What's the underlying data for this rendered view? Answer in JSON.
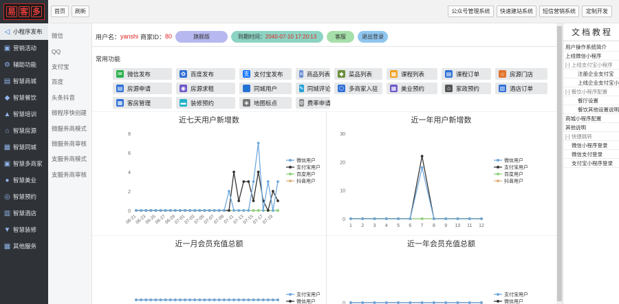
{
  "logo": {
    "chars": [
      "易",
      "客",
      "多"
    ]
  },
  "sidebar": {
    "items": [
      {
        "label": "小程序发布",
        "icon": "send-icon",
        "active": true
      },
      {
        "label": "营销活动",
        "icon": "tag-icon"
      },
      {
        "label": "辅助功能",
        "icon": "settings-icon"
      },
      {
        "label": "智慧商城",
        "icon": "shop-icon"
      },
      {
        "label": "智慧餐饮",
        "icon": "dining-icon"
      },
      {
        "label": "智慧培训",
        "icon": "training-icon"
      },
      {
        "label": "智慧房源",
        "icon": "house-icon"
      },
      {
        "label": "智慧同城",
        "icon": "city-icon"
      },
      {
        "label": "智慧多商家",
        "icon": "merchants-icon"
      },
      {
        "label": "智慧美业",
        "icon": "beauty-icon"
      },
      {
        "label": "智慧预约",
        "icon": "appointment-icon"
      },
      {
        "label": "智慧酒店",
        "icon": "hotel-icon"
      },
      {
        "label": "智慧装修",
        "icon": "decoration-icon"
      },
      {
        "label": "其他服务",
        "icon": "grid-icon"
      }
    ]
  },
  "submenu": {
    "items": [
      "微信",
      "QQ",
      "支付宝",
      "百度",
      "头条抖音",
      "微程序快创建",
      "微服务商模式",
      "微服务商审核",
      "支服务商模式",
      "支服务商审核"
    ]
  },
  "topbar": {
    "home": "首页",
    "refresh": "刷新",
    "right_buttons": [
      "公众号管理系统",
      "快速建站系统",
      "短信营销系统",
      "定制开发"
    ]
  },
  "user": {
    "username_label": "用户名：",
    "username": "yanshi",
    "merchant_label": "商家ID：",
    "merchant_id": "80",
    "edition": "旗舰版",
    "expire_label": "到期时间：",
    "expire_time": "2040-07-10 17:20:13",
    "service": "客服",
    "logout": "退出登录"
  },
  "common": {
    "title": "常用功能",
    "buttons": [
      {
        "label": "微信发布",
        "icon": "wechat-icon",
        "color": "#2bb24c"
      },
      {
        "label": "百度发布",
        "icon": "baidu-paw-icon",
        "color": "#2f6fd6"
      },
      {
        "label": "支付宝发布",
        "icon": "alipay-icon",
        "color": "#1677ff"
      },
      {
        "label": "商品列表",
        "icon": "list-icon",
        "color": "#6b8fd4"
      },
      {
        "label": "菜品列表",
        "icon": "dish-icon",
        "color": "#6a8f3a"
      },
      {
        "label": "课程列表",
        "icon": "course-list-icon",
        "color": "#f0a020"
      },
      {
        "label": "课程订单",
        "icon": "order-icon",
        "color": "#2f6fd6"
      },
      {
        "label": "房源门店",
        "icon": "store-icon",
        "color": "#e2742c"
      },
      {
        "label": "房源申请",
        "icon": "apply-icon",
        "color": "#2f6fd6"
      },
      {
        "label": "房源求租",
        "icon": "rent-icon",
        "color": "#6f57c7"
      },
      {
        "label": "同城用户",
        "icon": "user-icon",
        "color": "#2f6fd6"
      },
      {
        "label": "同城评论",
        "icon": "comment-icon",
        "color": "#23a0d6"
      },
      {
        "label": "多商家入驻",
        "icon": "join-icon",
        "color": "#2f6fd6"
      },
      {
        "label": "美业预约",
        "icon": "beauty-book-icon",
        "color": "#6f57c7"
      },
      {
        "label": "家政预约",
        "icon": "housekeeping-icon",
        "color": "#555555"
      },
      {
        "label": "酒店订单",
        "icon": "hotel-order-icon",
        "color": "#2f6fd6"
      },
      {
        "label": "客房管理",
        "icon": "room-icon",
        "color": "#2f6fd6"
      },
      {
        "label": "装修预约",
        "icon": "decor-book-icon",
        "color": "#23b3c8"
      },
      {
        "label": "地图标点",
        "icon": "map-pin-icon",
        "color": "#777777"
      },
      {
        "label": "费率申请",
        "icon": "rate-icon",
        "color": "#888888"
      }
    ]
  },
  "chart_data": [
    {
      "type": "line",
      "title": "近七天用户新增数",
      "x": [
        "06-21",
        "06-23",
        "06-25",
        "06-27",
        "06-29",
        "07-01",
        "07-03",
        "07-05",
        "07-07",
        "07-09",
        "07-11",
        "07-13",
        "07-15",
        "07-17",
        "07-19"
      ],
      "x_full": [
        "06-21",
        "06-22",
        "06-23",
        "06-24",
        "06-25",
        "06-26",
        "06-27",
        "06-28",
        "06-29",
        "06-30",
        "07-01",
        "07-02",
        "07-03",
        "07-04",
        "07-05",
        "07-06",
        "07-07",
        "07-08",
        "07-09",
        "07-10",
        "07-11",
        "07-12",
        "07-13",
        "07-14",
        "07-15",
        "07-16",
        "07-17",
        "07-18",
        "07-19",
        "07-20"
      ],
      "yticks": [
        0,
        2,
        4,
        6,
        8
      ],
      "ylim": [
        0,
        8
      ],
      "series": [
        {
          "name": "微信用户",
          "color": "#6fa8dc",
          "values": [
            0,
            0,
            0,
            0,
            0,
            0,
            0,
            0,
            0,
            0,
            0,
            0,
            0,
            0,
            0,
            0,
            0,
            0,
            0,
            2,
            0,
            0,
            0,
            0,
            3,
            7,
            0,
            3,
            0,
            3
          ]
        },
        {
          "name": "支付宝用户",
          "color": "#333333",
          "values": [
            0,
            0,
            0,
            0,
            0,
            0,
            0,
            0,
            0,
            0,
            0,
            0,
            0,
            0,
            0,
            0,
            0,
            0,
            0,
            0,
            4,
            1,
            3,
            3,
            1,
            4,
            1,
            0,
            2,
            1
          ]
        },
        {
          "name": "百度用户",
          "color": "#8bd07a",
          "values": [
            0,
            0,
            0,
            0,
            0,
            0,
            0,
            0,
            0,
            0,
            0,
            0,
            0,
            0,
            0,
            0,
            0,
            0,
            0,
            0,
            0,
            0,
            0,
            0,
            0,
            0,
            0,
            0,
            0,
            0
          ]
        },
        {
          "name": "抖音用户",
          "color": "#e0b080",
          "values": [
            0,
            0,
            0,
            0,
            0,
            0,
            0,
            0,
            0,
            0,
            0,
            0,
            0,
            0,
            0,
            0,
            0,
            0,
            0,
            0,
            0,
            0,
            0,
            0,
            0,
            0,
            0,
            0,
            0,
            0
          ]
        }
      ]
    },
    {
      "type": "line",
      "title": "近一年用户新增数",
      "x": [
        "1",
        "2",
        "3",
        "4",
        "5",
        "6",
        "7",
        "8",
        "9",
        "10",
        "11",
        "12"
      ],
      "yticks": [
        0,
        10,
        20,
        30
      ],
      "ylim": [
        0,
        30
      ],
      "series": [
        {
          "name": "微信用户",
          "color": "#6fa8dc",
          "values": [
            0,
            0,
            0,
            0,
            0,
            0,
            18,
            0,
            0,
            0,
            0,
            0
          ]
        },
        {
          "name": "支付宝用户",
          "color": "#333333",
          "values": [
            0,
            0,
            0,
            0,
            0,
            0,
            22,
            0,
            0,
            0,
            0,
            0
          ]
        },
        {
          "name": "百度用户",
          "color": "#8bd07a",
          "values": [
            0,
            0,
            0,
            0,
            0,
            0,
            0,
            0,
            0,
            0,
            0,
            0
          ]
        },
        {
          "name": "抖音用户",
          "color": "#e0b080",
          "values": [
            0,
            0,
            0,
            0,
            0,
            0,
            0,
            0,
            0,
            0,
            0,
            0
          ]
        }
      ]
    },
    {
      "type": "line",
      "title": "近一月会员充值总额",
      "n_points": 30,
      "series": [
        {
          "name": "支付宝用户",
          "color": "#6fa8dc",
          "values": [
            0,
            0,
            0,
            0,
            0,
            0,
            0,
            0,
            0,
            0,
            0,
            0,
            0,
            0,
            0,
            0,
            0,
            0,
            0,
            0,
            0,
            0,
            0,
            0,
            0,
            0,
            0,
            0,
            0,
            0
          ]
        },
        {
          "name": "微信用户",
          "color": "#333333",
          "values": [
            0,
            0,
            0,
            0,
            0,
            0,
            0,
            0,
            0,
            0,
            0,
            0,
            0,
            0,
            0,
            0,
            0,
            0,
            0,
            0,
            0,
            0,
            0,
            0,
            0,
            0,
            0,
            0,
            0,
            0
          ]
        }
      ]
    },
    {
      "type": "line",
      "title": "近一年会员充值总额",
      "yticks": [
        0
      ],
      "n_points": 12,
      "series": [
        {
          "name": "支付宝用户",
          "color": "#6fa8dc",
          "values": [
            0,
            0,
            0,
            0,
            0,
            0,
            0,
            0,
            0,
            0,
            0,
            0
          ]
        },
        {
          "name": "微信用户",
          "color": "#333333",
          "values": [
            0,
            0,
            0,
            0,
            0,
            0,
            0,
            0,
            0,
            0,
            0,
            0
          ]
        }
      ]
    }
  ],
  "docs": {
    "title": "文档教程",
    "items": [
      {
        "label": "用户操作系统简介",
        "indent": 0
      },
      {
        "label": "上线微信小程序",
        "indent": 0
      },
      {
        "label": "[-] 上线支付宝小程序",
        "indent": 0,
        "muted": true
      },
      {
        "label": "注册企业支付宝",
        "indent": 2
      },
      {
        "label": "上线企业支付宝小",
        "indent": 2
      },
      {
        "label": "[-] 餐饮小程序配置",
        "indent": 0,
        "muted": true
      },
      {
        "label": "餐厅设置",
        "indent": 2
      },
      {
        "label": "餐饮其他设置说明",
        "indent": 2
      },
      {
        "label": "商城小程序配置",
        "indent": 0
      },
      {
        "label": "其他说明",
        "indent": 0
      },
      {
        "label": "[-] 快捷跳转",
        "indent": 0,
        "muted": true
      },
      {
        "label": "微信小程序登录",
        "indent": 1
      },
      {
        "label": "微信支付登录",
        "indent": 1
      },
      {
        "label": "支付宝小程序登录",
        "indent": 1
      }
    ]
  }
}
